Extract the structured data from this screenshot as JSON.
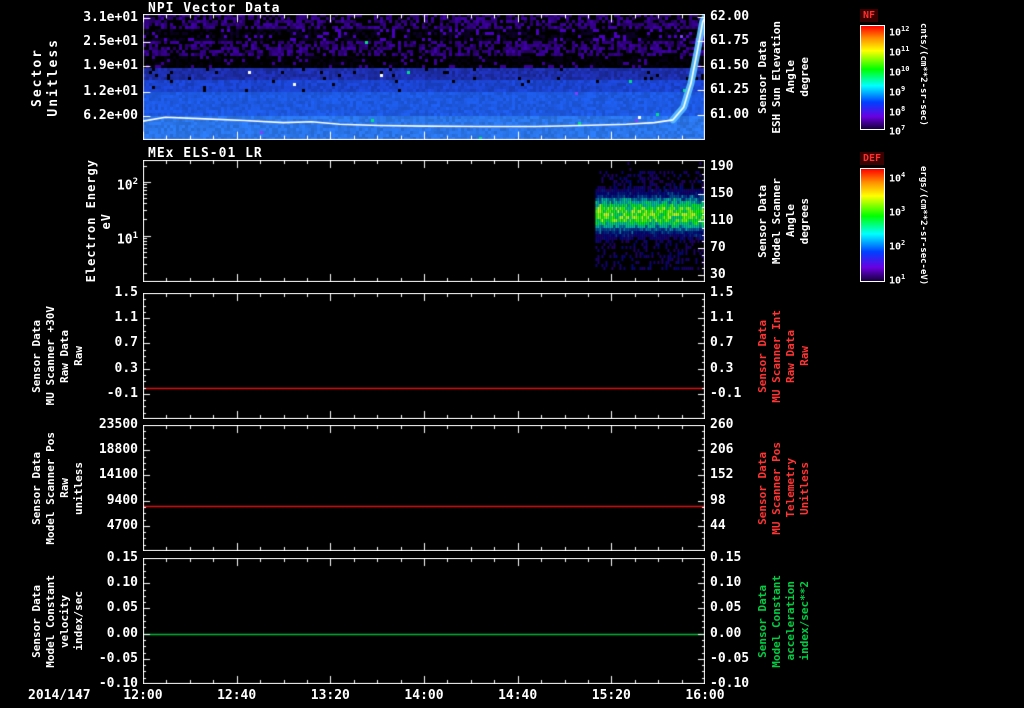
{
  "page": {
    "background": "#000000",
    "foreground": "#ffffff"
  },
  "x_axis": {
    "date_label": "2014/147",
    "tick_labels": [
      "12:00",
      "12:40",
      "13:20",
      "14:00",
      "14:40",
      "15:20",
      "16:00"
    ],
    "minor_ticks_per_major": 4,
    "range_minutes": 240
  },
  "chart_data": [
    {
      "id": "npi-vector-data",
      "type": "heatmap",
      "title": "NPI Vector Data",
      "left_axis": {
        "title_lines": [
          "Sector",
          "Unitless"
        ],
        "color": "#ffffff",
        "range": [
          32,
          0
        ],
        "ticks": [
          {
            "label": "3.1e+01",
            "frac": 0.03
          },
          {
            "label": "2.5e+01",
            "frac": 0.22
          },
          {
            "label": "1.9e+01",
            "frac": 0.41
          },
          {
            "label": "1.2e+01",
            "frac": 0.62
          },
          {
            "label": "6.2e+00",
            "frac": 0.81
          }
        ]
      },
      "right_axis": {
        "title_lines": [
          "Sensor Data",
          "ESH Sun Elevation",
          "Angle",
          "degree"
        ],
        "color": "#ffffff",
        "range": [
          62.0,
          61.0
        ],
        "ticks": [
          {
            "label": "62.00",
            "frac": 0.02
          },
          {
            "label": "61.75",
            "frac": 0.215
          },
          {
            "label": "61.50",
            "frac": 0.41
          },
          {
            "label": "61.25",
            "frac": 0.605
          },
          {
            "label": "61.00",
            "frac": 0.8
          }
        ]
      },
      "bands": [
        {
          "from": 0.0,
          "to": 0.125,
          "base": "#4000aa",
          "jitter": 0.5,
          "black": 0.4,
          "speck_p": 0.0
        },
        {
          "from": 0.125,
          "to": 0.215,
          "base": "#0e0030",
          "jitter": 0.6,
          "black": 0.5,
          "speck": "#4a00c0",
          "speck_p": 0.16
        },
        {
          "from": 0.215,
          "to": 0.345,
          "base": "#4000aa",
          "jitter": 0.5,
          "black": 0.4,
          "speck_p": 0.0
        },
        {
          "from": 0.345,
          "to": 0.43,
          "base": "#070018",
          "jitter": 0.5,
          "black": 0.55,
          "speck": "#3a0096",
          "speck_p": 0.08
        },
        {
          "from": 0.43,
          "to": 0.52,
          "base": "#2236c8",
          "jitter": 0.3,
          "black": 0.04,
          "speck_p": 0.0
        },
        {
          "from": 0.52,
          "to": 0.62,
          "base": "#1e4ce8",
          "jitter": 0.22,
          "black": 0.02,
          "speck_p": 0.0
        },
        {
          "from": 0.62,
          "to": 0.8,
          "base": "#2062f8",
          "jitter": 0.18,
          "black": 0.0,
          "speck_p": 0.0
        },
        {
          "from": 0.8,
          "to": 1.0,
          "base": "#2e80ff",
          "jitter": 0.18,
          "black": 0.0,
          "speck_p": 0.0
        }
      ],
      "overlay_line": {
        "color": "#ffffff",
        "points": [
          [
            0.0,
            0.85
          ],
          [
            0.04,
            0.82
          ],
          [
            0.1,
            0.83
          ],
          [
            0.18,
            0.845
          ],
          [
            0.25,
            0.862
          ],
          [
            0.3,
            0.855
          ],
          [
            0.35,
            0.875
          ],
          [
            0.42,
            0.885
          ],
          [
            0.5,
            0.89
          ],
          [
            0.6,
            0.893
          ],
          [
            0.7,
            0.893
          ],
          [
            0.78,
            0.885
          ],
          [
            0.86,
            0.875
          ],
          [
            0.91,
            0.862
          ],
          [
            0.943,
            0.84
          ],
          [
            0.962,
            0.74
          ],
          [
            0.975,
            0.55
          ],
          [
            0.987,
            0.28
          ],
          [
            0.996,
            0.06
          ],
          [
            1.0,
            0.03
          ]
        ]
      },
      "colorbar": {
        "header": "NF",
        "header_color": "#ff3030",
        "unit": "cnts/(cm**2-sr-sec)",
        "ticks": [
          {
            "label": "10",
            "sup": "12",
            "frac": 0.03
          },
          {
            "label": "10",
            "sup": "11",
            "frac": 0.22
          },
          {
            "label": "10",
            "sup": "10",
            "frac": 0.41
          },
          {
            "label": "10",
            "sup": "9",
            "frac": 0.6
          },
          {
            "label": "10",
            "sup": "8",
            "frac": 0.79
          },
          {
            "label": "10",
            "sup": "7",
            "frac": 0.97
          }
        ]
      }
    },
    {
      "id": "mex-els-01-lr",
      "type": "heatmap",
      "title": "MEx ELS-01 LR",
      "left_axis": {
        "title_lines": [
          "Electron Energy",
          "eV"
        ],
        "color": "#ffffff",
        "scale": "log",
        "decade_frac": 0.44,
        "log_decades": [
          {
            "label": "10",
            "sup": "2",
            "frac": 0.18
          },
          {
            "label": "10",
            "sup": "1",
            "frac": 0.62
          }
        ]
      },
      "right_axis": {
        "title_lines": [
          "Sensor Data",
          "Model Scanner",
          "Angle",
          "degrees"
        ],
        "color": "#ffffff",
        "range": [
          200,
          20
        ],
        "ticks": [
          {
            "label": "190",
            "frac": 0.056
          },
          {
            "label": "150",
            "frac": 0.278
          },
          {
            "label": "110",
            "frac": 0.5
          },
          {
            "label": "70",
            "frac": 0.722
          },
          {
            "label": "30",
            "frac": 0.944
          }
        ]
      },
      "patch": {
        "x_from": 0.805,
        "x_to": 1.0,
        "band_center": 0.43,
        "band_sigma": 0.09,
        "start_time": "15:10",
        "end_time": "16:00"
      },
      "colorbar": {
        "header": "DEF",
        "header_color": "#ff3030",
        "unit": "ergs/(cm**2-sr-sec-eV)",
        "ticks": [
          {
            "label": "10",
            "sup": "4",
            "frac": 0.05
          },
          {
            "label": "10",
            "sup": "3",
            "frac": 0.35
          },
          {
            "label": "10",
            "sup": "2",
            "frac": 0.65
          },
          {
            "label": "10",
            "sup": "1",
            "frac": 0.95
          }
        ]
      }
    },
    {
      "id": "mu-scanner-raw",
      "type": "line",
      "left_axis": {
        "title_lines": [
          "Sensor Data",
          "MU Scanner +30V",
          "Raw Data",
          "Raw"
        ],
        "color": "#ffffff",
        "range": [
          1.5,
          -0.5
        ],
        "ticks": [
          {
            "label": "1.5",
            "frac": 0.0
          },
          {
            "label": "1.1",
            "frac": 0.2
          },
          {
            "label": "0.7",
            "frac": 0.4
          },
          {
            "label": "0.3",
            "frac": 0.6
          },
          {
            "label": "-0.1",
            "frac": 0.8
          }
        ]
      },
      "right_axis": {
        "title_lines": [
          "Sensor Data",
          "MU Scanner Int",
          "Raw Data",
          "Raw"
        ],
        "color": "#ff3434",
        "range": [
          1.5,
          -0.5
        ],
        "ticks": [
          {
            "label": "1.5",
            "frac": 0.0
          },
          {
            "label": "1.1",
            "frac": 0.2
          },
          {
            "label": "0.7",
            "frac": 0.4
          },
          {
            "label": "0.3",
            "frac": 0.6
          },
          {
            "label": "-0.1",
            "frac": 0.8
          }
        ]
      },
      "line": {
        "color": "#dc1414",
        "value": 0.0,
        "frac": 0.75
      }
    },
    {
      "id": "model-scanner-pos",
      "type": "line",
      "left_axis": {
        "title_lines": [
          "Sensor Data",
          "Model Scanner Pos",
          "Raw",
          "unitless"
        ],
        "color": "#ffffff",
        "range": [
          23500,
          0
        ],
        "ticks": [
          {
            "label": "23500",
            "frac": 0.0
          },
          {
            "label": "18800",
            "frac": 0.2
          },
          {
            "label": "14100",
            "frac": 0.4
          },
          {
            "label": "9400",
            "frac": 0.6
          },
          {
            "label": "4700",
            "frac": 0.8
          }
        ]
      },
      "right_axis": {
        "title_lines": [
          "Sensor Data",
          "MU Scanner Pos",
          "Telemetry",
          "Unitless"
        ],
        "color": "#ff3434",
        "range": [
          260,
          -10
        ],
        "ticks": [
          {
            "label": "260",
            "frac": 0.0
          },
          {
            "label": "206",
            "frac": 0.2
          },
          {
            "label": "152",
            "frac": 0.4
          },
          {
            "label": "98",
            "frac": 0.6
          },
          {
            "label": "44",
            "frac": 0.8
          }
        ]
      },
      "line": {
        "color": "#dc1414",
        "value": 8800,
        "frac": 0.64
      }
    },
    {
      "id": "model-constant",
      "type": "line",
      "left_axis": {
        "title_lines": [
          "Sensor Data",
          "Model Constant",
          "velocity",
          "index/sec"
        ],
        "color": "#ffffff",
        "range": [
          0.15,
          -0.1
        ],
        "ticks": [
          {
            "label": "0.15",
            "frac": 0.0
          },
          {
            "label": "0.10",
            "frac": 0.2
          },
          {
            "label": "0.05",
            "frac": 0.4
          },
          {
            "label": "0.00",
            "frac": 0.6
          },
          {
            "label": "-0.05",
            "frac": 0.8
          },
          {
            "label": "-0.10",
            "frac": 1.0
          }
        ]
      },
      "right_axis": {
        "title_lines": [
          "Sensor Data",
          "Model Constant",
          "acceleration",
          "index/sec**2"
        ],
        "color": "#00cc44",
        "range": [
          0.15,
          -0.1
        ],
        "ticks": [
          {
            "label": "0.15",
            "frac": 0.0
          },
          {
            "label": "0.10",
            "frac": 0.2
          },
          {
            "label": "0.05",
            "frac": 0.4
          },
          {
            "label": "0.00",
            "frac": 0.6
          },
          {
            "label": "-0.05",
            "frac": 0.8
          },
          {
            "label": "-0.10",
            "frac": 1.0
          }
        ]
      },
      "line": {
        "color": "#00b838",
        "value": 0.0,
        "frac": 0.6
      }
    }
  ]
}
